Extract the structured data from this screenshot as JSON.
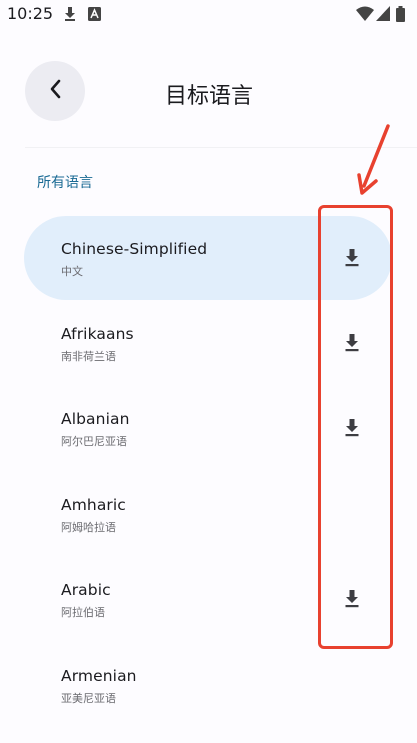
{
  "status_bar": {
    "time": "10:25",
    "icons": [
      "download-icon",
      "app-notification-icon",
      "wifi-icon",
      "signal-icon",
      "battery-icon"
    ]
  },
  "header": {
    "back_icon": "chevron-left-icon",
    "title": "目标语言"
  },
  "section": {
    "label": "所有语言"
  },
  "languages": [
    {
      "name": "Chinese-Simplified",
      "native": "中文",
      "selected": true,
      "downloadable": true
    },
    {
      "name": "Afrikaans",
      "native": "南非荷兰语",
      "selected": false,
      "downloadable": true
    },
    {
      "name": "Albanian",
      "native": "阿尔巴尼亚语",
      "selected": false,
      "downloadable": true
    },
    {
      "name": "Amharic",
      "native": "阿姆哈拉语",
      "selected": false,
      "downloadable": false
    },
    {
      "name": "Arabic",
      "native": "阿拉伯语",
      "selected": false,
      "downloadable": true
    },
    {
      "name": "Armenian",
      "native": "亚美尼亚语",
      "selected": false,
      "downloadable": false
    }
  ],
  "colors": {
    "accent": "#1a6a94",
    "selected_bg": "#e1eefb",
    "annotation": "#e8412f"
  }
}
